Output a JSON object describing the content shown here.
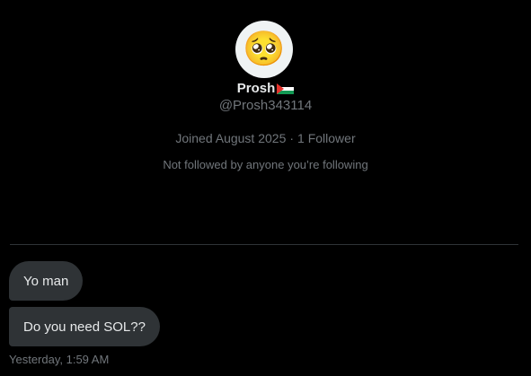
{
  "profile": {
    "avatar_emoji": "🥺",
    "avatar_icon": "pleading-face-emoji",
    "display_name": "Prosh",
    "flag_icon": "palestine-flag",
    "handle": "@Prosh343114",
    "joined": "Joined August 2025",
    "separator": "·",
    "followers": "1 Follower",
    "not_followed_note": "Not followed by anyone you’re following"
  },
  "messages": [
    {
      "text": "Yo man"
    },
    {
      "text": "Do you need SOL??"
    }
  ],
  "timestamp": "Yesterday, 1:59 AM",
  "colors": {
    "background": "#000000",
    "bubble": "#2f3336",
    "primary_text": "#e7e9ea",
    "secondary_text": "#71767b",
    "divider": "#2f3336"
  }
}
